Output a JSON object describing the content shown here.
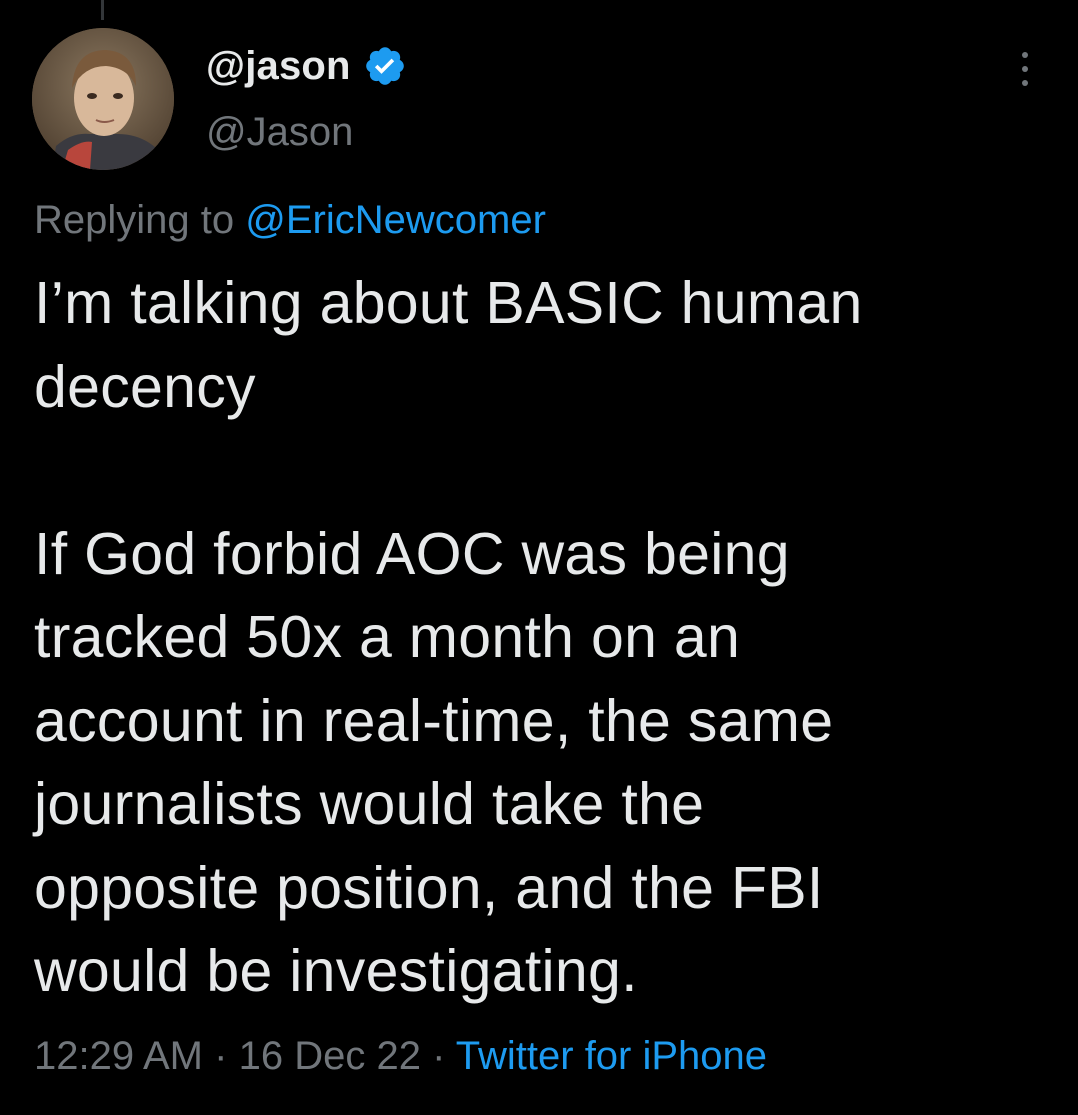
{
  "tweet": {
    "display_name": "@jason",
    "handle": "@Jason",
    "verified_icon": "verified-badge-icon",
    "more_icon": "more-options-icon",
    "replying_prefix": "Replying to",
    "replying_to": "@EricNewcomer",
    "text_line1": "I’m talking about BASIC human",
    "text_line2": "decency",
    "text_line3": "If God forbid AOC was being",
    "text_line4": "tracked 50x a month on an",
    "text_line5": "account in real-time, the same",
    "text_line6": "journalists would take the",
    "text_line7": "opposite position, and the FBI",
    "text_line8": "would be investigating.",
    "time": "12:29 AM",
    "separator": "·",
    "date": "16 Dec 22",
    "source": "Twitter for iPhone"
  },
  "colors": {
    "background": "#000000",
    "text_primary": "#e7e9ea",
    "text_secondary": "#71767b",
    "accent": "#1d9bf0"
  }
}
